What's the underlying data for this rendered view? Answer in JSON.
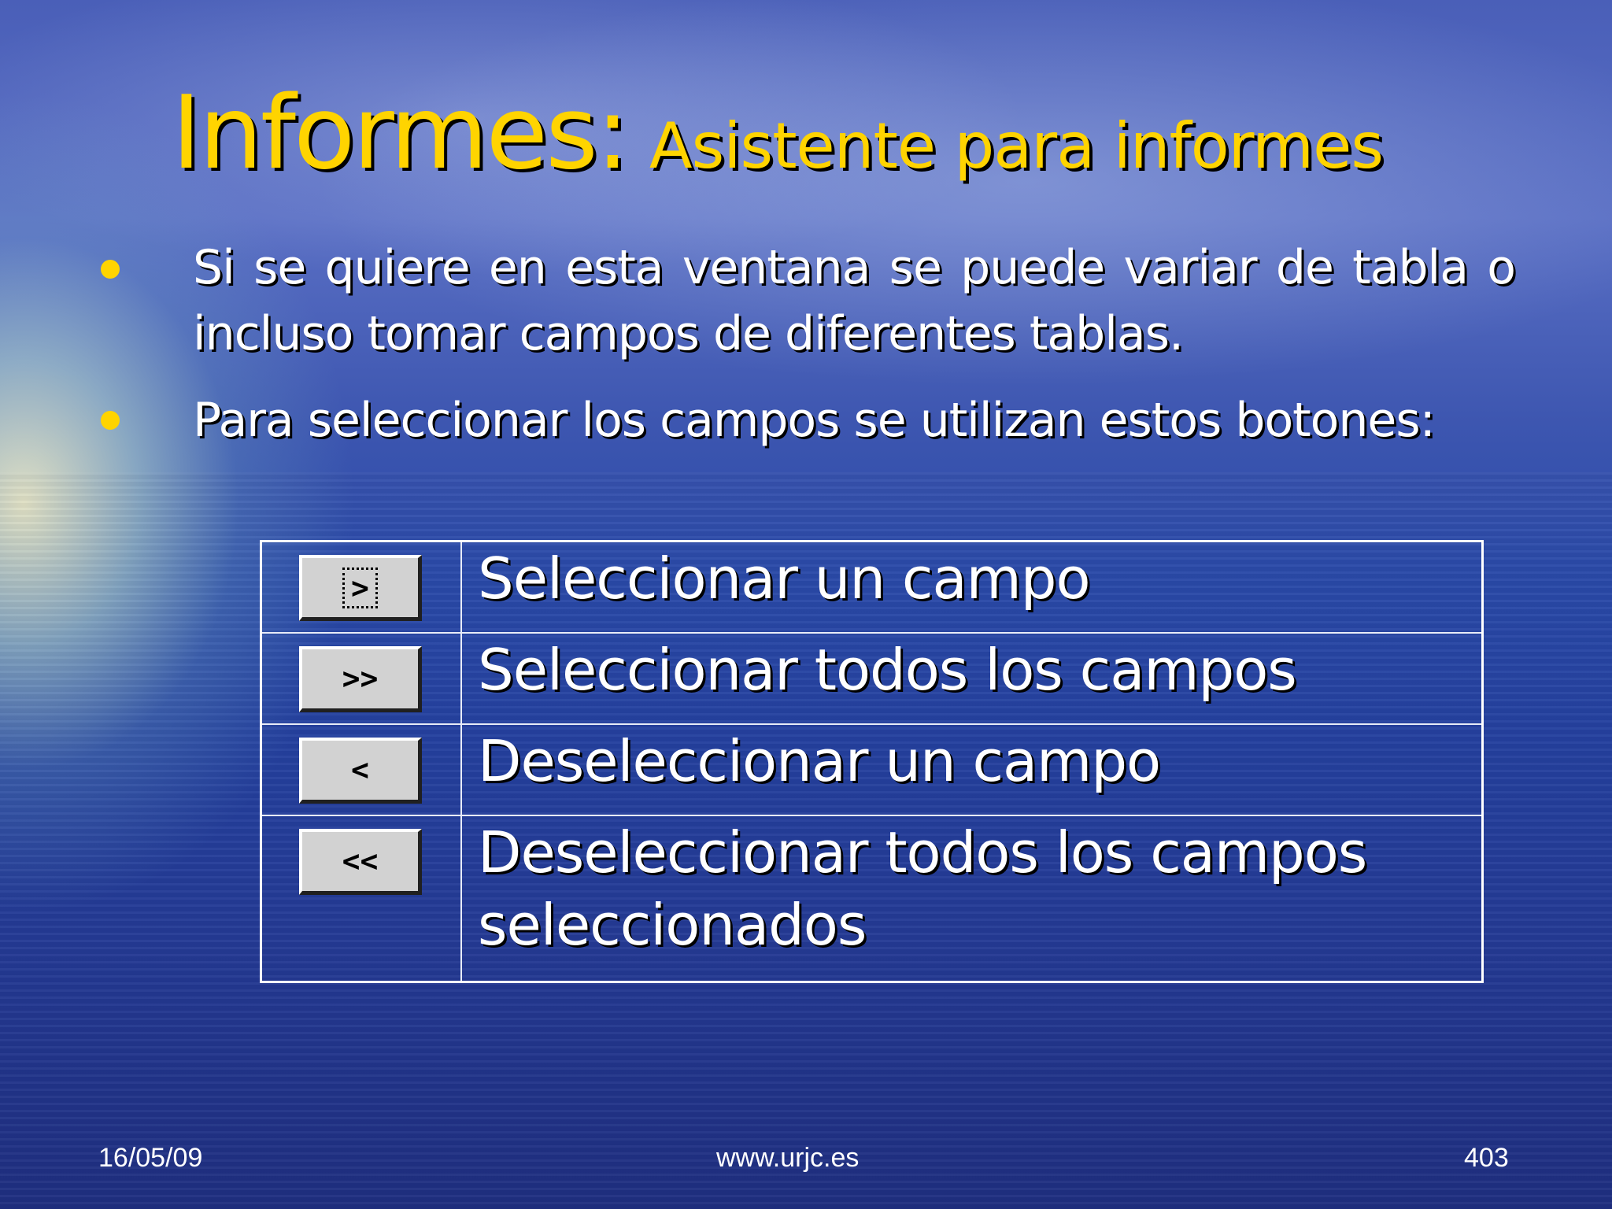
{
  "slide": {
    "title_main": "Informes:",
    "title_sub": "Asistente para informes",
    "bullets": [
      "Si se quiere en esta ventana se puede variar de tabla o incluso tomar campos de diferentes tablas.",
      "Para seleccionar los campos se utilizan estos botones:"
    ],
    "buttons": [
      {
        "glyph": ">",
        "label": "Seleccionar un campo",
        "icon": "select-one-icon"
      },
      {
        "glyph": ">>",
        "label": "Seleccionar todos los campos",
        "icon": "select-all-icon"
      },
      {
        "glyph": "<",
        "label": "Deseleccionar un campo",
        "icon": "deselect-one-icon"
      },
      {
        "glyph": "<<",
        "label": "Deseleccionar todos los campos seleccionados",
        "icon": "deselect-all-icon"
      }
    ]
  },
  "footer": {
    "date": "16/05/09",
    "site": "www.urjc.es",
    "page": "403"
  },
  "colors": {
    "title": "#ffd400",
    "bullet": "#ffd400",
    "text": "#ffffff"
  }
}
